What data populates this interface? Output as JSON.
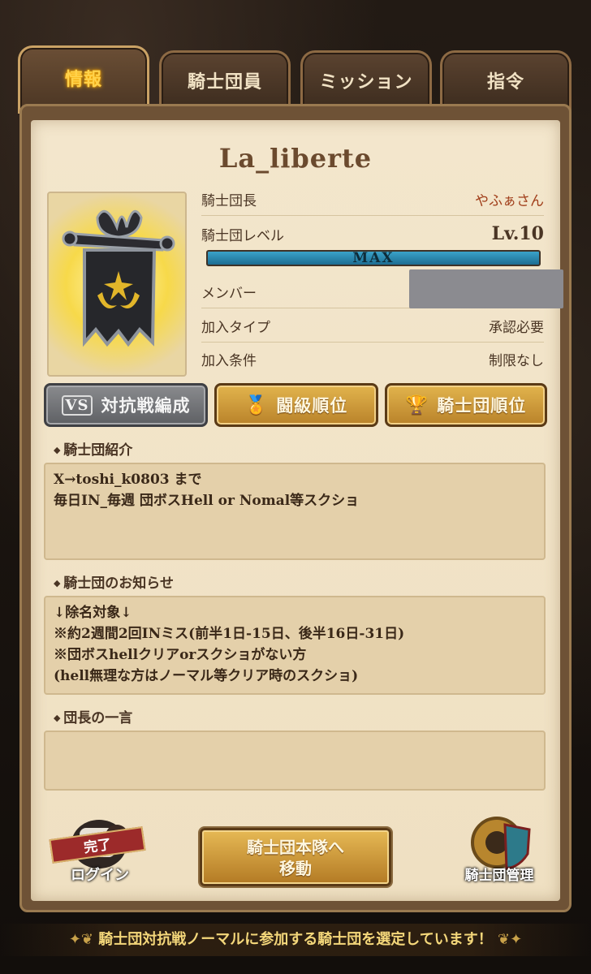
{
  "tabs": [
    {
      "label": "情報",
      "active": true
    },
    {
      "label": "騎士団員",
      "active": false
    },
    {
      "label": "ミッション",
      "active": false
    },
    {
      "label": "指令",
      "active": false
    }
  ],
  "guild": {
    "name": "La_liberte",
    "rows": [
      {
        "label": "騎士団長",
        "value": "やふぁさん"
      },
      {
        "label": "騎士団レベル",
        "value": "Lv.10"
      },
      {
        "label": "メンバー",
        "value": ""
      },
      {
        "label": "加入タイプ",
        "value": "承認必要"
      },
      {
        "label": "加入条件",
        "value": "制限なし"
      }
    ],
    "level_bar_label": "MAX",
    "level_bar_fill": 1.0
  },
  "buttons": {
    "versus": "対抗戦編成",
    "rank_tier": "闘級順位",
    "guild_rank": "騎士団順位"
  },
  "sections": {
    "intro_title": "騎士団紹介",
    "intro_lines": [
      "X→toshi_k0803 まで",
      "毎日IN_毎週 団ボスHell or Nomal等スクショ"
    ],
    "notice_title": "騎士団のお知らせ",
    "notice_lines": [
      "↓除名対象↓",
      "※約2週間2回INミス(前半1日-15日、後半16日-31日)",
      "※団ボスhellクリアorスクショがない方",
      "(hell無理な方はノーマル等クリア時のスクショ)"
    ],
    "leader_word_title": "団長の一言"
  },
  "bottom": {
    "login_stamp": "完了",
    "login_label": "ログイン",
    "move_line1": "騎士団本隊へ",
    "move_line2": "移動",
    "manage_label": "騎士団管理"
  },
  "footer": "騎士団対抗戦ノーマルに参加する騎士団を選定しています！",
  "colors": {
    "accent_gold": "#ffd24a",
    "leader_name": "#a03e1a",
    "level_bar": "#3aa2c9"
  }
}
